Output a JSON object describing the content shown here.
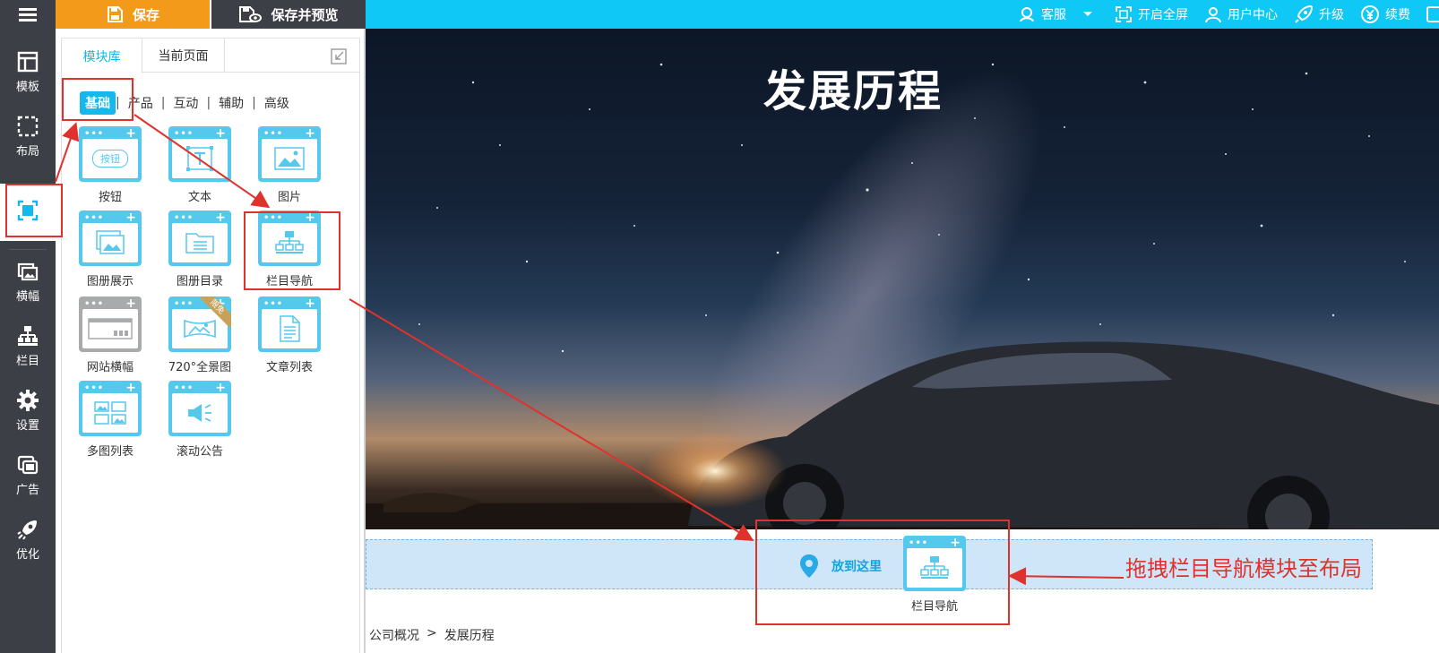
{
  "rail": {
    "items": [
      {
        "label": "模板",
        "icon": "template-icon"
      },
      {
        "label": "布局",
        "icon": "layout-icon"
      },
      {
        "label": "",
        "icon": "module-icon"
      },
      {
        "label": "横幅",
        "icon": "banner-icon"
      },
      {
        "label": "栏目",
        "icon": "column-icon"
      },
      {
        "label": "设置",
        "icon": "gear-icon"
      },
      {
        "label": "广告",
        "icon": "ad-icon"
      },
      {
        "label": "优化",
        "icon": "rocket-icon"
      }
    ]
  },
  "toolbar": {
    "save_label": "保存",
    "save_preview_label": "保存并预览"
  },
  "topbar": {
    "links": [
      "客服",
      "开启全屏",
      "用户中心",
      "升级",
      "续费"
    ]
  },
  "panel": {
    "tabs": [
      "模块库",
      "当前页面"
    ],
    "categories": [
      "基础",
      "产品",
      "互动",
      "辅助",
      "高级"
    ],
    "modules": [
      "按钮",
      "文本",
      "图片",
      "图册展示",
      "图册目录",
      "栏目导航",
      "网站横幅",
      "720°全景图",
      "文章列表",
      "多图列表",
      "滚动公告"
    ],
    "ribbon": "限免",
    "button_icon_text": "按钮"
  },
  "canvas": {
    "hero_title": "发展历程",
    "drop_label": "放到这里",
    "drag_module_label": "栏目导航",
    "breadcrumb": [
      "公司概况",
      ">",
      "发展历程"
    ]
  },
  "annotation": "拖拽栏目导航模块至布局",
  "colors": {
    "accent": "#10c8f5",
    "save": "#f39a1a",
    "rail": "#3c3f45",
    "annotation": "#e0322d"
  }
}
